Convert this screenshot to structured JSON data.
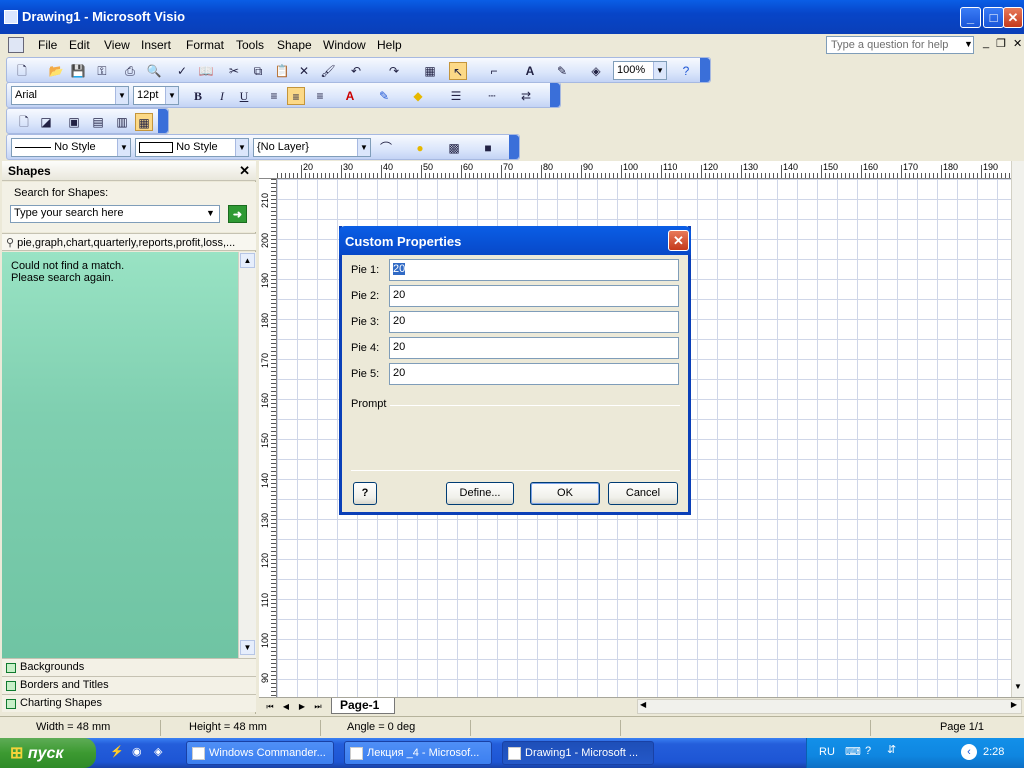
{
  "window": {
    "title": "Drawing1 - Microsoft Visio"
  },
  "menu": [
    "File",
    "Edit",
    "View",
    "Insert",
    "Format",
    "Tools",
    "Shape",
    "Window",
    "Help"
  ],
  "help_box": {
    "placeholder": "Type a question for help"
  },
  "toolbar": {
    "zoom": "100%"
  },
  "format_toolbar": {
    "font": "Arial",
    "size": "12pt"
  },
  "style_toolbar": {
    "line_style": "No Style",
    "fill_style": "No Style",
    "layer": "{No Layer}"
  },
  "shapes_pane": {
    "title": "Shapes",
    "search_label": "Search for Shapes:",
    "search_placeholder": "Type your search here",
    "result_tab": "pie,graph,chart,quarterly,reports,profit,loss,...",
    "message_line1": "Could not find a match.",
    "message_line2": "Please search again.",
    "stencils": [
      "Backgrounds",
      "Borders and Titles",
      "Charting Shapes"
    ]
  },
  "rulers": {
    "top_ticks": [
      "20",
      "30",
      "40",
      "50",
      "60",
      "70",
      "80",
      "90",
      "100",
      "110",
      "120",
      "130",
      "140",
      "150",
      "160",
      "170",
      "180",
      "190"
    ],
    "left_ticks": [
      "210",
      "200",
      "190",
      "180",
      "170",
      "160",
      "150",
      "140",
      "130",
      "120",
      "110",
      "100",
      "90"
    ]
  },
  "page_tab": "Page-1",
  "dialog": {
    "title": "Custom Properties",
    "fields": [
      {
        "label": "Pie 1:",
        "value": "20"
      },
      {
        "label": "Pie 2:",
        "value": "20"
      },
      {
        "label": "Pie 3:",
        "value": "20"
      },
      {
        "label": "Pie 4:",
        "value": "20"
      },
      {
        "label": "Pie 5:",
        "value": "20"
      }
    ],
    "prompt_label": "Prompt",
    "define_button": "Define...",
    "ok_button": "OK",
    "cancel_button": "Cancel"
  },
  "status": {
    "width": "Width = 48 mm",
    "height": "Height = 48 mm",
    "angle": "Angle = 0 deg",
    "page": "Page 1/1"
  },
  "taskbar": {
    "start": "пуск",
    "tasks": [
      "Windows Commander...",
      "Лекция _4 - Microsof...",
      "Drawing1 - Microsoft ..."
    ],
    "language": "RU",
    "clock": "2:28"
  },
  "colors": {
    "title_blue": "#0a5ee6",
    "shapes_green": "#7fcfb0",
    "taskbar_blue": "#245edb",
    "start_green": "#3c9a31"
  }
}
